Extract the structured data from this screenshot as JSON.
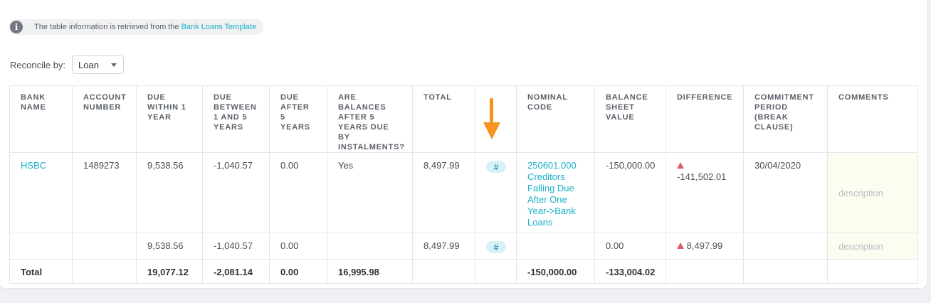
{
  "info": {
    "icon": "info-icon",
    "text": "The table information is retrieved from the",
    "link": "Bank Loans Template"
  },
  "reconcile": {
    "label": "Reconcile by:",
    "value": "Loan"
  },
  "table": {
    "headers": {
      "bank_name": "BANK NAME",
      "account_number": "ACCOUNT NUMBER",
      "due_1yr": "DUE WITHIN 1 YEAR",
      "due_1_5": "DUE BETWEEN 1 AND 5 YEARS",
      "due_5plus": "DUE AFTER 5 YEARS",
      "instalments": "ARE BALANCES AFTER 5 YEARS DUE BY INSTALMENTS?",
      "total": "TOTAL",
      "hash": "",
      "nominal_code": "NOMINAL CODE",
      "balance_sheet": "BALANCE SHEET VALUE",
      "difference": "DIFFERENCE",
      "commitment": "COMMITMENT PERIOD (BREAK CLAUSE)",
      "comments": "COMMENTS"
    },
    "rows": [
      {
        "bank_name": "HSBC",
        "account_number": "1489273",
        "due_1yr": "9,538.56",
        "due_1_5": "-1,040.57",
        "due_5plus": "0.00",
        "instalments": "Yes",
        "total": "8,497.99",
        "hash": "#",
        "nominal_code": "250601.000 Creditors Falling Due After One Year->Bank Loans",
        "balance_sheet": "-150,000.00",
        "difference": "-141,502.01",
        "commitment": "30/04/2020",
        "comments": "description"
      },
      {
        "bank_name": "",
        "account_number": "",
        "due_1yr": "9,538.56",
        "due_1_5": "-1,040.57",
        "due_5plus": "0.00",
        "instalments": "",
        "total": "8,497.99",
        "hash": "#",
        "nominal_code": "",
        "balance_sheet": "0.00",
        "difference": "8,497.99",
        "commitment": "",
        "comments": "description"
      }
    ],
    "total_row": {
      "label": "Total",
      "due_1yr": "19,077.12",
      "due_1_5": "-2,081.14",
      "due_5plus": "0.00",
      "instalments": "16,995.98",
      "nominal_code": "-150,000.00",
      "balance_sheet": "-133,004.02"
    }
  },
  "colors": {
    "accent": "#1ab0c8",
    "warning_triangle": "#e25a72",
    "arrow": "#f7931e",
    "comment_bg": "#fdfcf0"
  },
  "icons": {
    "difference": "warning-triangle-icon",
    "pointer": "arrow-down-icon",
    "dropdown": "caret-down-icon"
  }
}
